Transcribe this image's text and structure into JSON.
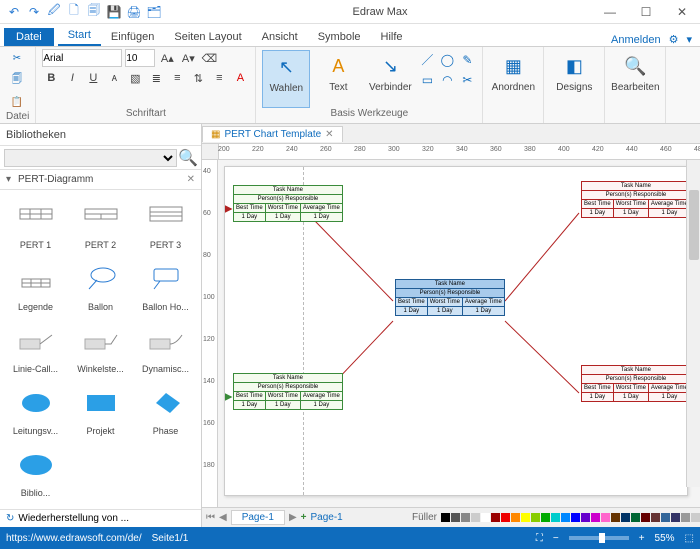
{
  "app": {
    "title": "Edraw Max"
  },
  "win": {
    "min": "—",
    "max": "☐",
    "close": "✕"
  },
  "qat": [
    "↶",
    "↷",
    "🖉",
    "🗋",
    "🗐",
    "💾",
    "🖨",
    "🗂"
  ],
  "ribbonTabs": {
    "file": "Datei",
    "items": [
      "Start",
      "Einfügen",
      "Seiten Layout",
      "Ansicht",
      "Symbole",
      "Hilfe"
    ],
    "active": 0,
    "signin": "Anmelden"
  },
  "ribbon": {
    "groupFile": "Datei",
    "groupFont": "Schriftart",
    "groupTools": "Basis Werkzeuge",
    "font": "Arial",
    "size": "10",
    "bold": "B",
    "italic": "I",
    "underline": "U",
    "select": "Wahlen",
    "text": "Text",
    "connector": "Verbinder",
    "arrange": "Anordnen",
    "designs": "Designs",
    "edit": "Bearbeiten"
  },
  "sidebar": {
    "title": "Bibliotheken",
    "section": "PERT-Diagramm",
    "shapes": [
      "PERT 1",
      "PERT 2",
      "PERT 3",
      "Legende",
      "Ballon",
      "Ballon Ho...",
      "Linie-Call...",
      "Winkelste...",
      "Dynamisc...",
      "Leitungsv...",
      "Projekt",
      "Phase",
      "Biblio..."
    ],
    "resume": "Wiederherstellung von ..."
  },
  "docTab": "PERT Chart Template",
  "ruler_h": [
    "200",
    "220",
    "240",
    "260",
    "280",
    "300",
    "320",
    "340",
    "360",
    "380",
    "400",
    "420",
    "440",
    "460",
    "48"
  ],
  "ruler_v": [
    "40",
    "60",
    "80",
    "100",
    "120",
    "140",
    "160",
    "180"
  ],
  "node": {
    "task": "Task Name",
    "person": "Person(s) Responsible",
    "best": "Best Time",
    "worst": "Worst Time",
    "avg": "Average Time",
    "day": "1 Day"
  },
  "pageTabs": {
    "fill": "Füller",
    "p1": "Page-1",
    "plus": "+",
    "p1b": "Page-1"
  },
  "status": {
    "url": "https://www.edrawsoft.com/de/",
    "page": "Seite1/1",
    "zoom": "55%"
  },
  "palette": [
    "#000",
    "#555",
    "#888",
    "#ccc",
    "#fff",
    "#900",
    "#e00",
    "#f80",
    "#ff0",
    "#8c0",
    "#0a0",
    "#0cc",
    "#08f",
    "#00f",
    "#60c",
    "#c0c",
    "#f6c",
    "#630",
    "#036",
    "#063",
    "#600",
    "#633",
    "#369",
    "#336",
    "#999",
    "#ccc"
  ]
}
